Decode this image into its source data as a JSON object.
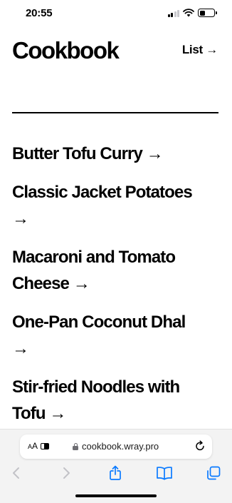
{
  "status_bar": {
    "time": "20:55"
  },
  "header": {
    "title": "Cookbook",
    "list_link": "List →"
  },
  "recipes": [
    {
      "line1": "Butter Tofu Curry →",
      "line2": ""
    },
    {
      "line1": "Classic Jacket Potatoes",
      "line2": "→"
    },
    {
      "line1": "Macaroni and Tomato",
      "line2": "Cheese →"
    },
    {
      "line1": "One-Pan Coconut Dhal",
      "line2": "→"
    },
    {
      "line1": "Stir-fried Noodles with",
      "line2": "Tofu →"
    }
  ],
  "browser": {
    "text_size_label_small": "A",
    "text_size_label_large": "A",
    "url": "cookbook.wray.pro",
    "accent_color": "#0a7aff",
    "disabled_color": "#c2c2c7"
  },
  "icons": {
    "reader": "reader-icon",
    "lock": "lock-icon",
    "reload": "reload-icon",
    "back": "chevron-left-icon",
    "forward": "chevron-right-icon",
    "share": "share-icon",
    "bookmarks": "book-icon",
    "tabs": "tabs-icon"
  }
}
